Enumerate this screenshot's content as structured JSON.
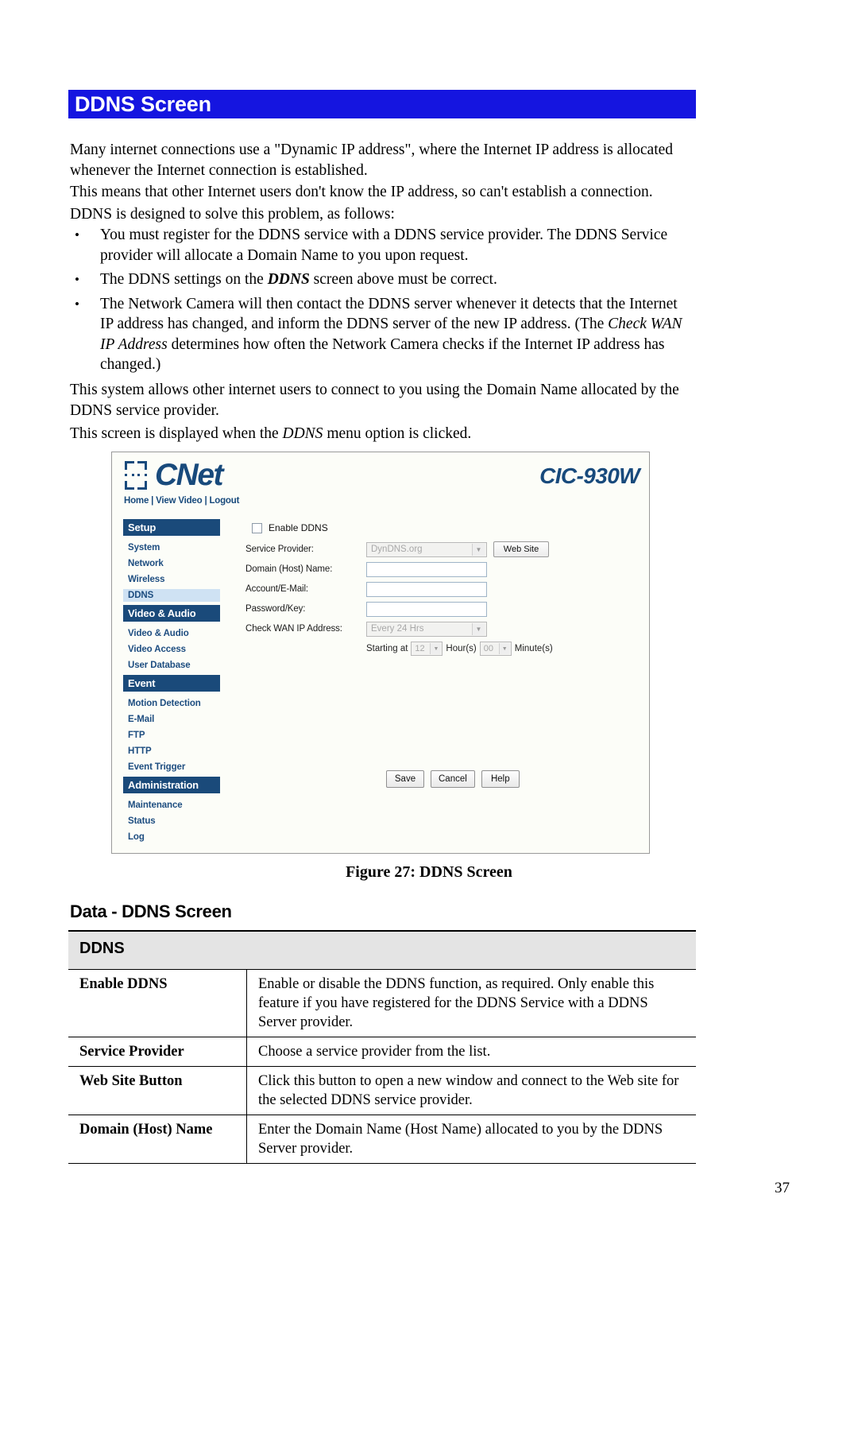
{
  "section": {
    "banner_title": "DDNS Screen",
    "banner_color": "#1515e0"
  },
  "intro": {
    "p1_a": "Many internet connections use a \"Dynamic IP address\", where the Internet IP address is allocated whenever the Internet connection is established.",
    "p2": "This means that other Internet users don't know the IP address, so can't establish a connection.",
    "p3": "DDNS is designed to solve this problem, as follows:",
    "p4": "This system allows other internet users to connect to you using the Domain Name allocated by the DDNS service provider.",
    "p5_a": "This screen is displayed when the ",
    "p5_em": "DDNS",
    "p5_b": " menu option is clicked."
  },
  "bullets": [
    {
      "marker": "•",
      "text_a": "You must register for the DDNS service with a DDNS service provider. The DDNS Service provider will allocate a Domain Name to you upon request.",
      "em": "",
      "text_b": ""
    },
    {
      "marker": "•",
      "text_a": "The DDNS settings on the ",
      "em": "DDNS",
      "text_b": " screen above must be correct."
    },
    {
      "marker": "•",
      "text_a": "The Network Camera will then contact the DDNS server whenever it detects that the Internet IP address has changed, and inform the DDNS server of the new IP address. (The ",
      "em": "Check WAN IP Address",
      "text_b": " determines how often the Network Camera checks if the Internet IP address has changed.)"
    }
  ],
  "figure": {
    "caption": "Figure 27: DDNS Screen",
    "ui": {
      "logo_text": "CNet",
      "nav_links": "Home | View Video | Logout",
      "model_name": "CIC-930W",
      "sidebar": [
        {
          "label": "Setup",
          "type": "group"
        },
        {
          "label": "System",
          "type": "item"
        },
        {
          "label": "Network",
          "type": "item"
        },
        {
          "label": "Wireless",
          "type": "item"
        },
        {
          "label": "DDNS",
          "type": "item",
          "active": true
        },
        {
          "label": "Video & Audio",
          "type": "group"
        },
        {
          "label": "Video & Audio",
          "type": "item"
        },
        {
          "label": "Video Access",
          "type": "item"
        },
        {
          "label": "User Database",
          "type": "item"
        },
        {
          "label": "Event",
          "type": "group"
        },
        {
          "label": "Motion Detection",
          "type": "item"
        },
        {
          "label": "E-Mail",
          "type": "item"
        },
        {
          "label": "FTP",
          "type": "item"
        },
        {
          "label": "HTTP",
          "type": "item"
        },
        {
          "label": "Event Trigger",
          "type": "item"
        },
        {
          "label": "Administration",
          "type": "group"
        },
        {
          "label": "Maintenance",
          "type": "item"
        },
        {
          "label": "Status",
          "type": "item"
        },
        {
          "label": "Log",
          "type": "item"
        }
      ],
      "form": {
        "enable_ddns_label": "Enable DDNS",
        "enable_ddns_checked": false,
        "service_provider_label": "Service Provider:",
        "service_provider_value": "DynDNS.org",
        "web_site_button": "Web Site",
        "domain_label": "Domain (Host) Name:",
        "domain_value": "",
        "account_label": "Account/E-Mail:",
        "account_value": "",
        "password_label": "Password/Key:",
        "password_value": "",
        "check_wan_label": "Check WAN IP Address:",
        "check_wan_value": "Every 24 Hrs",
        "starting_at_label": "Starting at",
        "hour_value": "12",
        "hour_unit": "Hour(s)",
        "minute_value": "00",
        "minute_unit": "Minute(s)"
      },
      "buttons": {
        "save": "Save",
        "cancel": "Cancel",
        "help": "Help"
      }
    }
  },
  "data_section": {
    "heading": "Data - DDNS Screen",
    "table_header": "DDNS",
    "rows": [
      {
        "key": "Enable DDNS",
        "value": "Enable or disable the DDNS function, as required. Only enable this feature if you have registered for the DDNS Service with a DDNS Server provider."
      },
      {
        "key": "Service Provider",
        "value": "Choose a service provider from the list."
      },
      {
        "key": "Web Site Button",
        "value": "Click this button to open a new window and connect to the Web site for the selected DDNS service provider."
      },
      {
        "key": "Domain (Host) Name",
        "value": "Enter the Domain Name (Host Name) allocated to you by the DDNS Server provider."
      }
    ]
  },
  "footer": {
    "page_number": "37"
  }
}
